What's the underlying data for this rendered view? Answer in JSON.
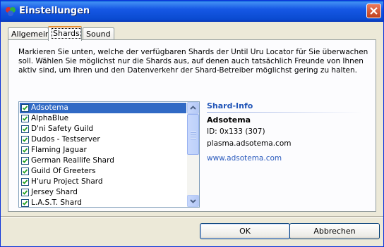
{
  "window": {
    "title": "Einstellungen",
    "accent": "#0a5fd8"
  },
  "tabs": [
    {
      "label": "Allgemein"
    },
    {
      "label": "Shards"
    },
    {
      "label": "Sound"
    }
  ],
  "active_tab": "Shards",
  "description": "Markieren Sie unten, welche der verfügbaren Shards der Until Uru Locator für Sie überwachen soll. Wählen Sie möglichst nur die Shards aus, auf denen auch tatsächlich Freunde von Ihnen aktiv sind, um Ihren und den Datenverkehr der Shard-Betreiber möglichst gering zu halten.",
  "shards": [
    {
      "name": "Adsotema",
      "checked": true,
      "selected": true
    },
    {
      "name": "AlphaBlue",
      "checked": true
    },
    {
      "name": "D'ni Safety Guild",
      "checked": true
    },
    {
      "name": "Dudos - Testserver",
      "checked": true
    },
    {
      "name": "Flaming Jaguar",
      "checked": true
    },
    {
      "name": "German Reallife Shard",
      "checked": true
    },
    {
      "name": "Guild Of Greeters",
      "checked": true
    },
    {
      "name": "H'uru Project Shard",
      "checked": true
    },
    {
      "name": "Jersey Shard",
      "checked": true
    },
    {
      "name": "L.A.S.T. Shard",
      "checked": true
    }
  ],
  "shard_info": {
    "heading": "Shard-Info",
    "name": "Adsotema",
    "id": "ID: 0x133 (307)",
    "host": "plasma.adsotema.com",
    "url": "www.adsotema.com"
  },
  "buttons": {
    "ok": "OK",
    "cancel": "Abbrechen"
  }
}
